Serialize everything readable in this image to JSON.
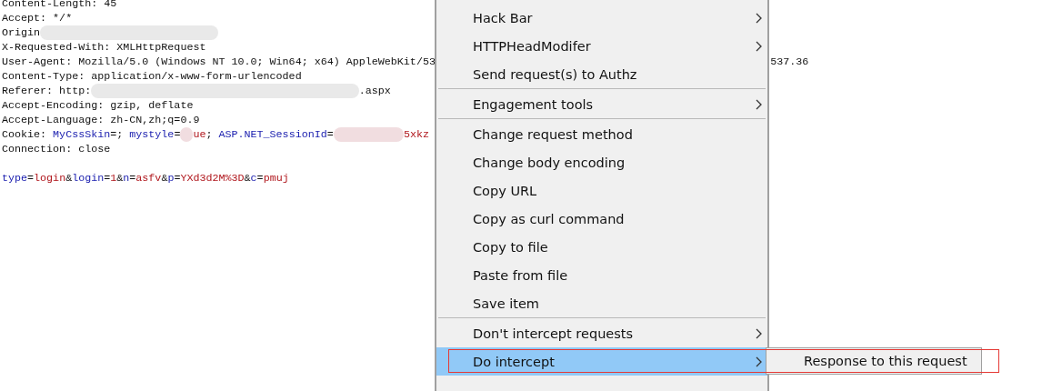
{
  "editor": {
    "lines": [
      {
        "segments": [
          {
            "kind": "plain",
            "text": "Content-Length: 45"
          }
        ]
      },
      {
        "segments": [
          {
            "kind": "plain",
            "text": "Accept: */*"
          }
        ]
      },
      {
        "segments": [
          {
            "kind": "plain",
            "text": "Origin"
          },
          {
            "kind": "redacted"
          }
        ]
      },
      {
        "segments": [
          {
            "kind": "plain",
            "text": "X-Requested-With: XMLHttpRequest"
          }
        ]
      },
      {
        "segments": [
          {
            "kind": "plain",
            "text": "User-Agent: Mozilla/5.0 (Windows NT 10.0; Win64; x64) AppleWebKit/53"
          }
        ],
        "tail": "537.36"
      },
      {
        "segments": [
          {
            "kind": "plain",
            "text": "Content-Type: application/x-www-form-urlencoded"
          }
        ]
      },
      {
        "segments": [
          {
            "kind": "plain",
            "text": "Referer: http:"
          },
          {
            "kind": "redacted"
          },
          {
            "kind": "plain",
            "text": ".aspx"
          }
        ]
      },
      {
        "segments": [
          {
            "kind": "plain",
            "text": "Accept-Encoding: gzip, deflate"
          }
        ]
      },
      {
        "segments": [
          {
            "kind": "plain",
            "text": "Accept-Language: zh-CN,zh;q=0.9"
          }
        ]
      },
      {
        "segments": [
          {
            "kind": "plain",
            "text": "Cookie: "
          },
          {
            "kind": "name",
            "text": "MyCssSkin"
          },
          {
            "kind": "plain",
            "text": "=; "
          },
          {
            "kind": "name",
            "text": "mystyle"
          },
          {
            "kind": "plain",
            "text": "="
          },
          {
            "kind": "redacted"
          },
          {
            "kind": "value",
            "text": "ue"
          },
          {
            "kind": "plain",
            "text": "; "
          },
          {
            "kind": "name",
            "text": "ASP.NET_SessionId"
          },
          {
            "kind": "plain",
            "text": "="
          },
          {
            "kind": "redacted"
          },
          {
            "kind": "value",
            "text": "5xkz"
          }
        ]
      },
      {
        "segments": [
          {
            "kind": "plain",
            "text": "Connection: close"
          }
        ]
      },
      {
        "kind": "blank"
      },
      {
        "segments": [
          {
            "kind": "name",
            "text": "type"
          },
          {
            "kind": "plain",
            "text": "="
          },
          {
            "kind": "value",
            "text": "login"
          },
          {
            "kind": "plain",
            "text": "&"
          },
          {
            "kind": "name",
            "text": "login"
          },
          {
            "kind": "plain",
            "text": "="
          },
          {
            "kind": "value",
            "text": "1"
          },
          {
            "kind": "plain",
            "text": "&"
          },
          {
            "kind": "name",
            "text": "n"
          },
          {
            "kind": "plain",
            "text": "="
          },
          {
            "kind": "value",
            "text": "asfv"
          },
          {
            "kind": "plain",
            "text": "&"
          },
          {
            "kind": "name",
            "text": "p"
          },
          {
            "kind": "plain",
            "text": "="
          },
          {
            "kind": "value",
            "text": "YXd3d2M%3D"
          },
          {
            "kind": "plain",
            "text": "&"
          },
          {
            "kind": "name",
            "text": "c"
          },
          {
            "kind": "plain",
            "text": "="
          },
          {
            "kind": "value",
            "text": "pmuj"
          }
        ]
      }
    ]
  },
  "context_menu": {
    "items": [
      {
        "kind": "item",
        "label": "Hack Bar",
        "submenu": true,
        "selected": false
      },
      {
        "kind": "item",
        "label": "HTTPHeadModifer",
        "submenu": true,
        "selected": false
      },
      {
        "kind": "item",
        "label": "Send request(s) to Authz",
        "submenu": false,
        "selected": false
      },
      {
        "kind": "separator"
      },
      {
        "kind": "item",
        "label": "Engagement tools",
        "submenu": true,
        "selected": false
      },
      {
        "kind": "separator"
      },
      {
        "kind": "item",
        "label": "Change request method",
        "submenu": false,
        "selected": false
      },
      {
        "kind": "item",
        "label": "Change body encoding",
        "submenu": false,
        "selected": false
      },
      {
        "kind": "item",
        "label": "Copy URL",
        "submenu": false,
        "selected": false
      },
      {
        "kind": "item",
        "label": "Copy as curl command",
        "submenu": false,
        "selected": false
      },
      {
        "kind": "item",
        "label": "Copy to file",
        "submenu": false,
        "selected": false
      },
      {
        "kind": "item",
        "label": "Paste from file",
        "submenu": false,
        "selected": false
      },
      {
        "kind": "item",
        "label": "Save item",
        "submenu": false,
        "selected": false
      },
      {
        "kind": "separator"
      },
      {
        "kind": "item",
        "label": "Don't intercept requests",
        "submenu": true,
        "selected": false
      },
      {
        "kind": "item",
        "label": "Do intercept",
        "submenu": true,
        "selected": true
      }
    ]
  },
  "submenu": {
    "items": [
      {
        "label": "Response to this request"
      }
    ]
  },
  "annotation": {
    "kind": "frame"
  }
}
